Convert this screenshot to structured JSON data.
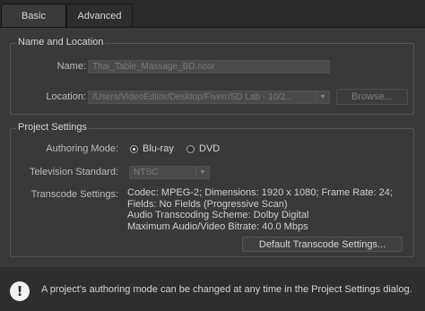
{
  "tabs": {
    "basic": "Basic",
    "advanced": "Advanced"
  },
  "name_location": {
    "legend": "Name and Location",
    "name_label": "Name:",
    "name_value": "Thai_Table_Massage_BD.ncor",
    "location_label": "Location:",
    "location_value": "/Users/VideoEditor/Desktop/Fiverr/SD Lab - 10/2...",
    "browse_label": "Browse..."
  },
  "project_settings": {
    "legend": "Project Settings",
    "authoring_mode_label": "Authoring Mode:",
    "authoring_options": [
      "Blu-ray",
      "DVD"
    ],
    "authoring_selected": "Blu-ray",
    "tv_standard_label": "Television Standard:",
    "tv_standard_value": "NTSC",
    "transcode_label": "Transcode Settings:",
    "transcode_lines": [
      "Codec: MPEG-2; Dimensions: 1920 x 1080; Frame Rate: 24;",
      "Fields: No Fields (Progressive Scan)",
      "Audio Transcoding Scheme: Dolby Digital",
      "Maximum Audio/Video Bitrate: 40.0 Mbps"
    ],
    "default_transcode_button": "Default Transcode Settings..."
  },
  "footer": {
    "icon": "exclamation-info-icon",
    "message": "A project's authoring mode can be changed at any time in the Project Settings dialog."
  }
}
